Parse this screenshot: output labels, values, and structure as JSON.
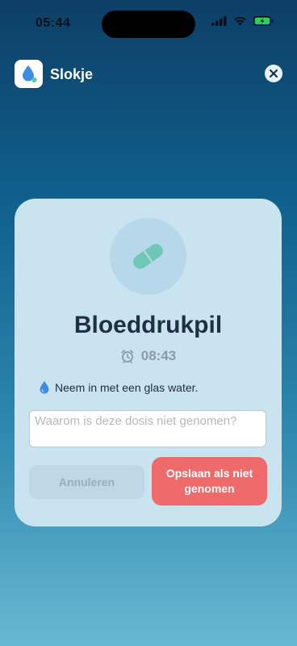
{
  "status_bar": {
    "time": "05:44",
    "icons": [
      "cellular-signal-icon",
      "wifi-icon",
      "battery-charging-icon"
    ]
  },
  "app": {
    "name": "Slokje",
    "icon": "water-drop-app-icon"
  },
  "card": {
    "medication_name": "Bloeddrukpil",
    "scheduled_time": "08:43",
    "instruction": "Neem in met een glas water.",
    "reason_placeholder": "Waarom is deze dosis niet genomen?",
    "reason_value": "",
    "cancel_label": "Annuleren",
    "save_label": "Opslaan als niet genomen"
  },
  "colors": {
    "accent_pill": "#6fc8b5",
    "save_button": "#ef6b6b",
    "card_background": "#c9e3ef",
    "title_text": "#1f2f44"
  }
}
